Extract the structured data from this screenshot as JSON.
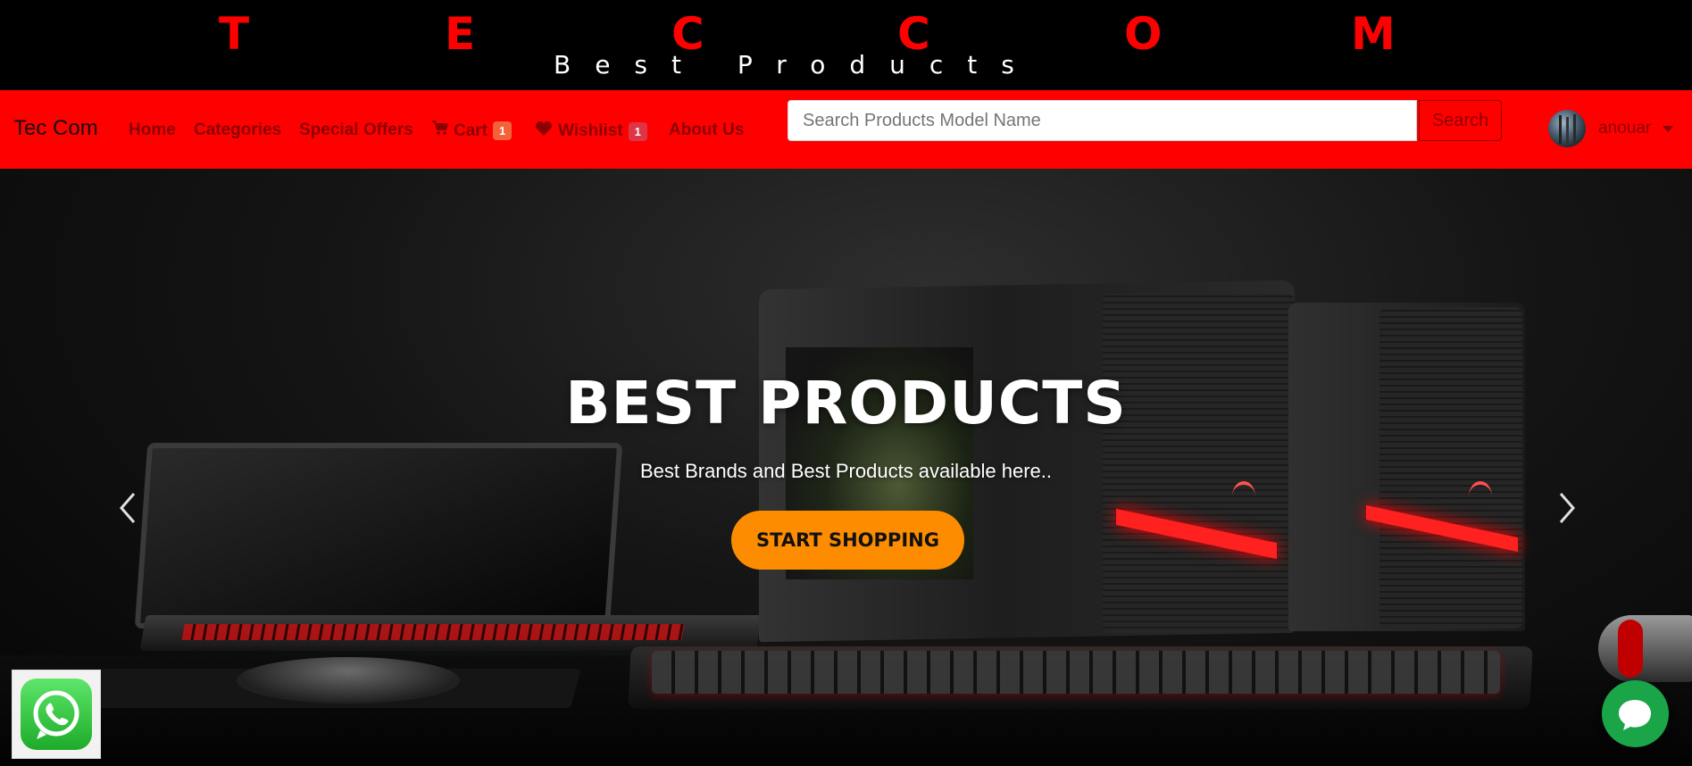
{
  "banner": {
    "logo_letters": [
      "T",
      "E",
      "C",
      "C",
      "O",
      "M"
    ],
    "tagline": "Best Products"
  },
  "navbar": {
    "brand": "Tec Com",
    "links": [
      {
        "label": "Home"
      },
      {
        "label": "Categories"
      },
      {
        "label": "Special Offers"
      },
      {
        "label": "Cart",
        "icon": "cart-icon",
        "badge": "1"
      },
      {
        "label": "Wishlist",
        "icon": "heart-icon",
        "badge": "1"
      },
      {
        "label": "About Us"
      }
    ],
    "search": {
      "placeholder": "Search Products Model Name",
      "value": "",
      "button_label": "Search"
    },
    "user": {
      "name": "anouar",
      "avatar_icon": "avatar-photo",
      "dropdown_icon": "caret-down-icon"
    }
  },
  "hero": {
    "title": "BEST PRODUCTS",
    "subtitle": "Best Brands and Best Products available here..",
    "cta_label": "START SHOPPING",
    "prev_icon": "chevron-left-icon",
    "next_icon": "chevron-right-icon"
  },
  "widgets": {
    "whatsapp_icon": "whatsapp-icon",
    "chat_icon": "chat-bubble-icon"
  },
  "colors": {
    "logo": "#ff0000",
    "navbar_bg": "#ff0000",
    "nav_text": "#8b0000",
    "cart_badge": "#f4623a",
    "wishlist_badge": "#dc3545",
    "cta_bg": "#fd8c00",
    "whatsapp": "#25d366",
    "chat": "#1aa549"
  }
}
